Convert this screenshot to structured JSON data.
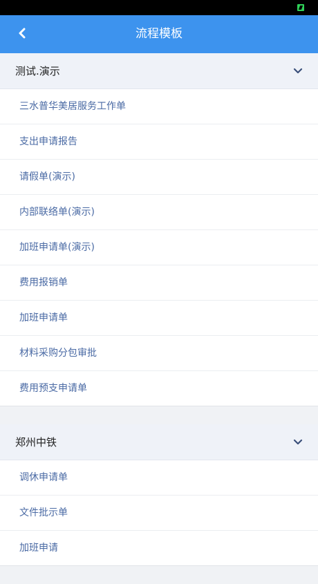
{
  "header": {
    "title": "流程模板",
    "back_icon": "chevron-left-icon",
    "bar_color": "#3d93ee"
  },
  "groups": [
    {
      "title": "测试.演示",
      "items": [
        "三水普华美居服务工作单",
        "支出申请报告",
        "请假单(演示)",
        "内部联络单(演示)",
        "加班申请单(演示)",
        "费用报销单",
        "加班申请单",
        "材料采购分包审批",
        "费用预支申请单"
      ]
    },
    {
      "title": "郑州中铁",
      "items": [
        "调休申请单",
        "文件批示单",
        "加班申请"
      ]
    }
  ]
}
